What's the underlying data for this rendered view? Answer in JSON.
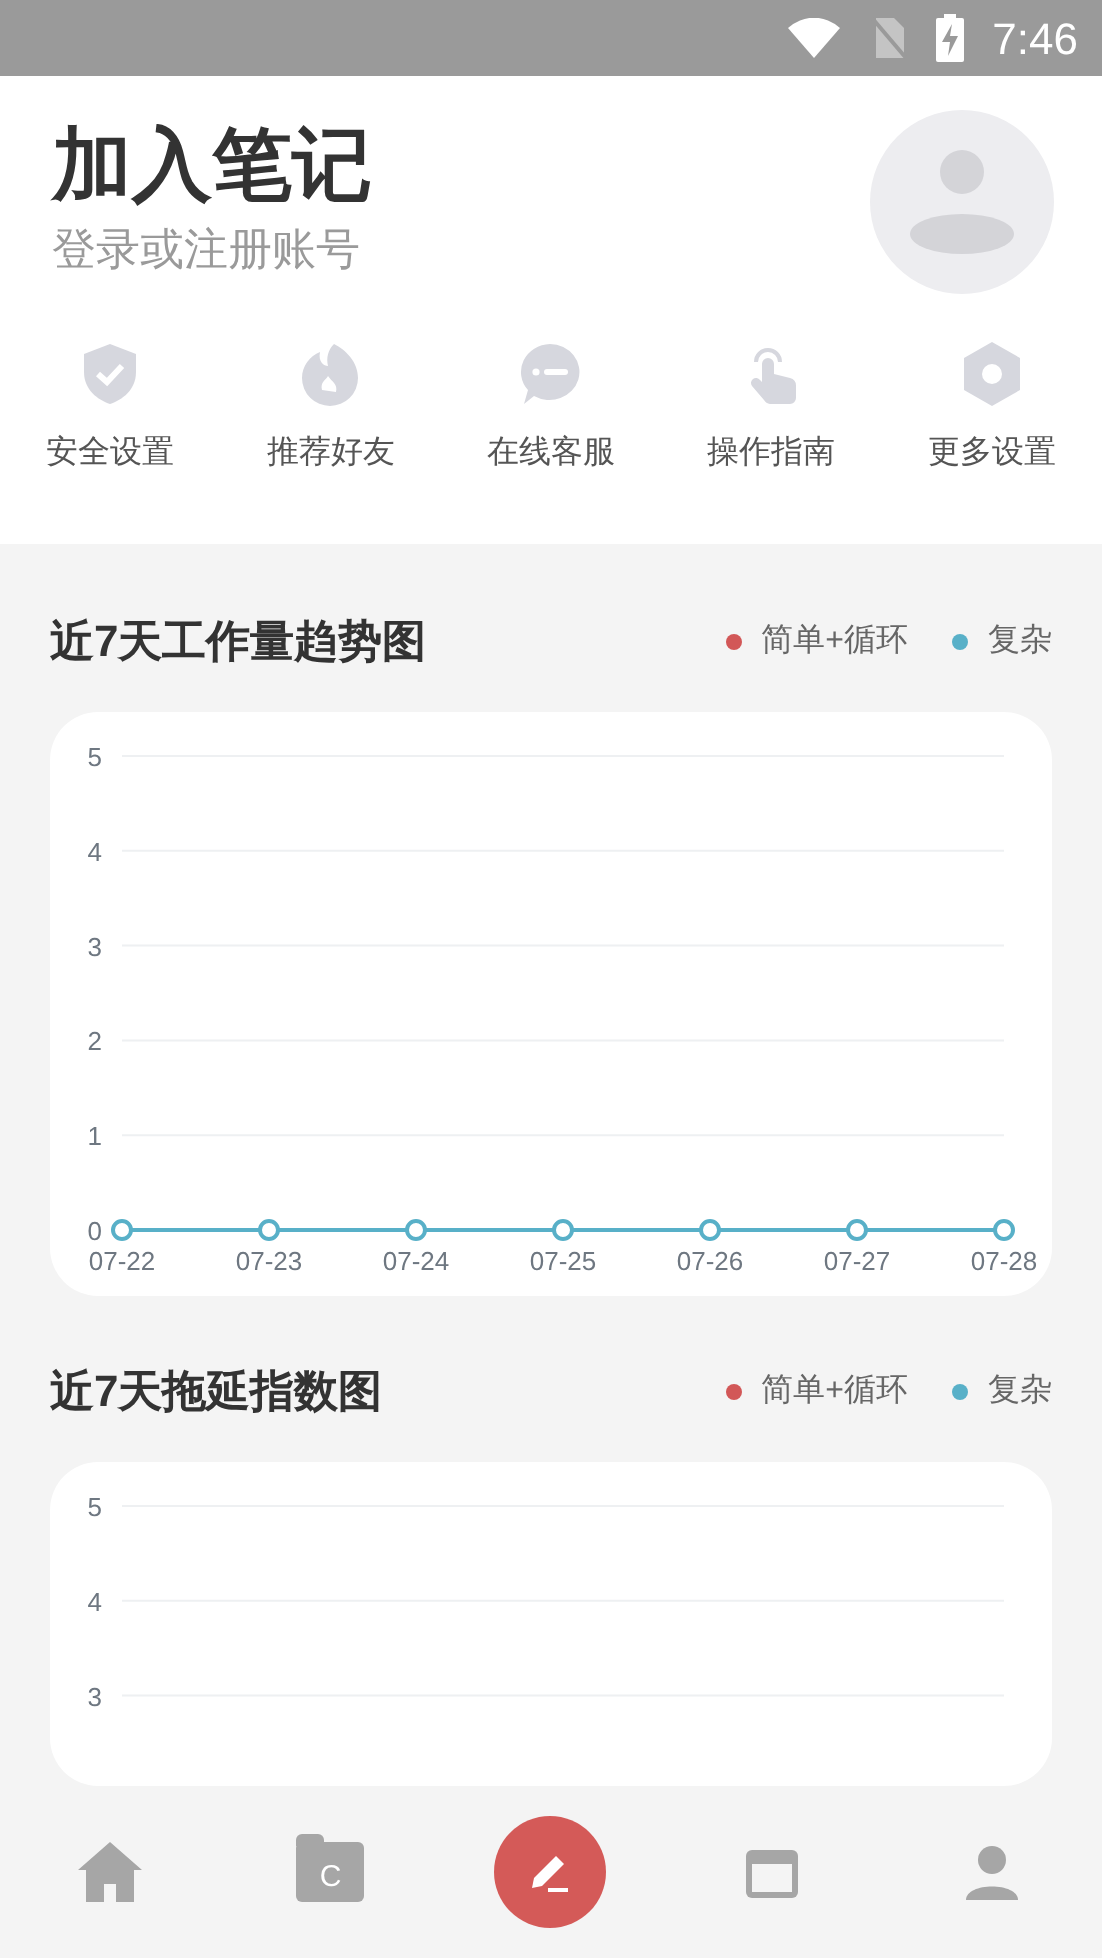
{
  "status_bar": {
    "time": "7:46"
  },
  "header": {
    "title": "加入笔记",
    "subtitle": "登录或注册账号"
  },
  "shortcuts": [
    {
      "label": "安全设置",
      "kind": "shield"
    },
    {
      "label": "推荐好友",
      "kind": "flame"
    },
    {
      "label": "在线客服",
      "kind": "chat"
    },
    {
      "label": "操作指南",
      "kind": "tap"
    },
    {
      "label": "更多设置",
      "kind": "hexagon"
    }
  ],
  "sections": [
    {
      "title": "近7天工作量趋势图",
      "chart_data": {
        "type": "line",
        "categories": [
          "07-22",
          "07-23",
          "07-24",
          "07-25",
          "07-26",
          "07-27",
          "07-28"
        ],
        "yticks": [
          0,
          1,
          2,
          3,
          4,
          5
        ],
        "ylim": [
          0,
          5
        ],
        "grid": true,
        "series": [
          {
            "name": "简单+循环",
            "color": "#d25757",
            "values": [
              null,
              null,
              null,
              null,
              null,
              null,
              null
            ]
          },
          {
            "name": "复杂",
            "color": "#58b0c8",
            "marker": true,
            "values": [
              0,
              0,
              0,
              0,
              0,
              0,
              0
            ]
          }
        ]
      }
    },
    {
      "title": "近7天拖延指数图",
      "legend": [
        {
          "label": "简单+循环",
          "color": "#d25757"
        },
        {
          "label": "复杂",
          "color": "#58b0c8"
        }
      ],
      "y_axis_labels": [
        "5",
        "4",
        "3"
      ]
    }
  ],
  "bottom_nav": [
    {
      "kind": "home"
    },
    {
      "kind": "folder",
      "label": "C"
    },
    {
      "kind": "compose"
    },
    {
      "kind": "calendar"
    },
    {
      "kind": "profile"
    }
  ]
}
